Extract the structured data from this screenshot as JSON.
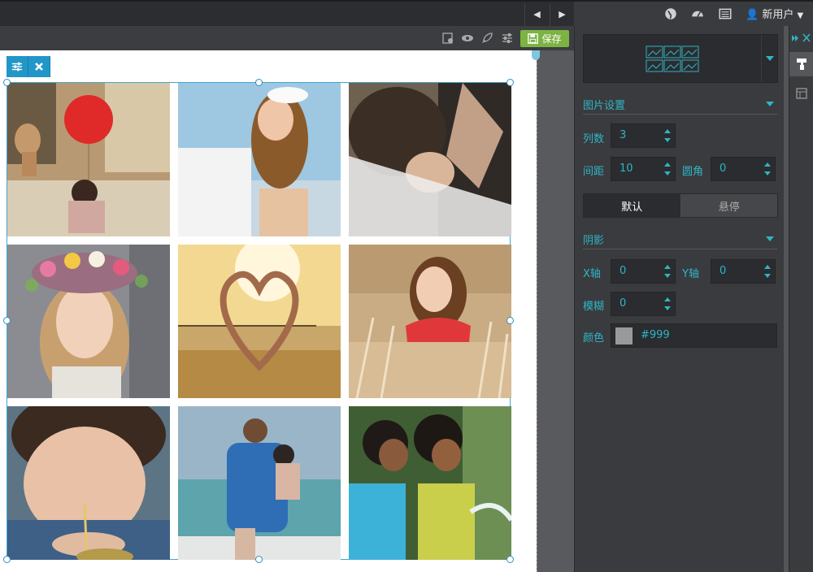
{
  "topbar": {
    "user_label": "新用户",
    "icons": [
      "chevron-left-icon",
      "chevron-right-icon",
      "globe-icon",
      "dashboard-icon",
      "list-icon",
      "user-icon",
      "caret-down-icon"
    ]
  },
  "edit_toolbar": {
    "save_label": "保存",
    "icons": [
      "page-settings-icon",
      "eye-icon",
      "rocket-icon",
      "sliders-icon",
      "floppy-icon"
    ]
  },
  "widget_tools": {
    "icons": [
      "sliders-icon",
      "close-icon"
    ]
  },
  "gallery": {
    "columns": 3,
    "images": [
      {
        "subject": "girl-with-red-balloon"
      },
      {
        "subject": "couple-embracing"
      },
      {
        "subject": "bride-veil"
      },
      {
        "subject": "girl-flower-crown"
      },
      {
        "subject": "heart-silhouette-beach"
      },
      {
        "subject": "woman-in-reeds"
      },
      {
        "subject": "child-drinking"
      },
      {
        "subject": "father-carrying-child"
      },
      {
        "subject": "kids-splashing-water"
      }
    ]
  },
  "sidebar": {
    "image_settings": {
      "title": "图片设置",
      "columns_label": "列数",
      "columns_value": "3",
      "spacing_label": "间距",
      "spacing_value": "10",
      "radius_label": "圆角",
      "radius_value": "0"
    },
    "states": {
      "default_label": "默认",
      "hover_label": "悬停"
    },
    "shadow": {
      "title": "阴影",
      "x_label": "X轴",
      "x_value": "0",
      "y_label": "Y轴",
      "y_value": "0",
      "blur_label": "模糊",
      "blur_value": "0",
      "color_label": "颜色",
      "color_value": "#999"
    }
  },
  "colors": {
    "accent": "#2fb5c6",
    "save_green": "#7cb342",
    "selection_blue": "#3fa5d6",
    "panel_bg": "#3a3b3e",
    "field_bg": "#2b2c2f"
  }
}
